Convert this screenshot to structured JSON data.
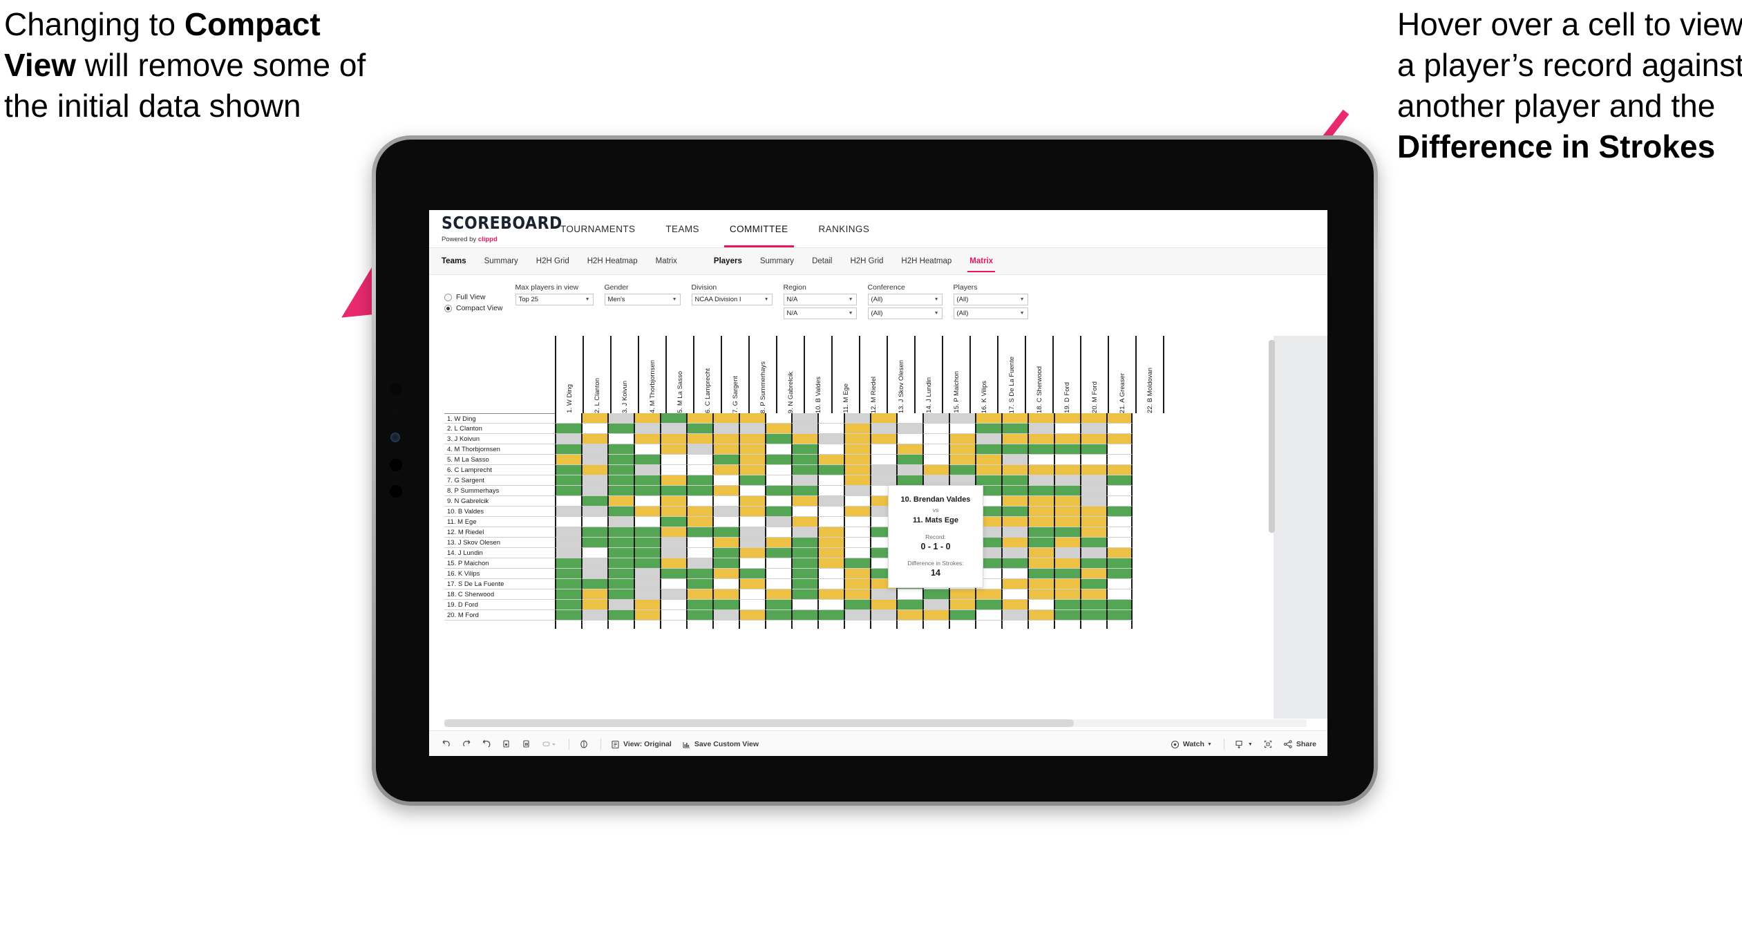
{
  "annotations": {
    "left": {
      "pre": "Changing to ",
      "bold": "Compact View",
      "post": " will remove some of the initial data shown"
    },
    "right": {
      "pre": "Hover over a cell to view a player’s record against another player and the ",
      "bold": "Difference in Strokes",
      "post": ""
    },
    "arrow_color": "#ea2a6e"
  },
  "app": {
    "logo": {
      "title": "SCOREBOARD",
      "powered_prefix": "Powered by ",
      "powered_brand": "clippd"
    },
    "top_nav": [
      {
        "label": "TOURNAMENTS",
        "active": false
      },
      {
        "label": "TEAMS",
        "active": false
      },
      {
        "label": "COMMITTEE",
        "active": true
      },
      {
        "label": "RANKINGS",
        "active": false
      }
    ],
    "sub_nav_teams": {
      "lead": "Teams",
      "items": [
        {
          "label": "Summary",
          "active": false
        },
        {
          "label": "H2H Grid",
          "active": false
        },
        {
          "label": "H2H Heatmap",
          "active": false
        },
        {
          "label": "Matrix",
          "active": false
        }
      ]
    },
    "sub_nav_players": {
      "lead": "Players",
      "items": [
        {
          "label": "Summary",
          "active": false
        },
        {
          "label": "Detail",
          "active": false
        },
        {
          "label": "H2H Grid",
          "active": false
        },
        {
          "label": "H2H Heatmap",
          "active": false
        },
        {
          "label": "Matrix",
          "active": true
        }
      ]
    },
    "view_options": [
      {
        "label": "Full View",
        "selected": false
      },
      {
        "label": "Compact View",
        "selected": true
      }
    ],
    "filters": [
      {
        "label": "Max players in view",
        "value": "Top 25",
        "value2": null
      },
      {
        "label": "Gender",
        "value": "Men's",
        "value2": null
      },
      {
        "label": "Division",
        "value": "NCAA Division I",
        "value2": null
      },
      {
        "label": "Region",
        "value": "N/A",
        "value2": "N/A"
      },
      {
        "label": "Conference",
        "value": "(All)",
        "value2": "(All)"
      },
      {
        "label": "Players",
        "value": "(All)",
        "value2": "(All)"
      }
    ],
    "tooltip": {
      "player_a": "10. Brendan Valdes",
      "vs": "vs",
      "player_b": "11. Mats Ege",
      "record_label": "Record:",
      "record_value": "0 - 1 - 0",
      "strokes_label": "Difference in Strokes:",
      "strokes_value": "14"
    },
    "toolbar": {
      "items": [
        {
          "icon": "undo-icon",
          "label": null
        },
        {
          "icon": "redo-icon",
          "label": null
        },
        {
          "icon": "revert-icon",
          "label": null
        },
        {
          "icon": "refresh-data-icon",
          "label": null
        },
        {
          "icon": "pause-updates-icon",
          "label": null
        },
        {
          "icon": "highlight-icon",
          "label": null
        },
        {
          "icon": "show-me-icon",
          "label": null
        },
        {
          "icon": "view-original-icon",
          "label": "View: Original"
        },
        {
          "icon": "save-custom-view-icon",
          "label": "Save Custom View"
        },
        {
          "icon": "watch-icon",
          "label": "Watch"
        },
        {
          "icon": "download-icon",
          "label": null
        },
        {
          "icon": "fullscreen-icon",
          "label": null
        },
        {
          "icon": "share-icon",
          "label": "Share"
        }
      ]
    }
  },
  "chart_data": {
    "type": "heatmap",
    "title": "Player Head-to-Head Matrix",
    "legend_colors": {
      "win": "#54a654",
      "tie": "#edc143",
      "loss": "#d2d2d2",
      "none": "#ffffff"
    },
    "row_labels": [
      "1. W Ding",
      "2. L Clanton",
      "3. J Koivun",
      "4. M Thorbjornsen",
      "5. M La Sasso",
      "6. C Lamprecht",
      "7. G Sargent",
      "8. P Summerhays",
      "9. N Gabrelcik",
      "10. B Valdes",
      "11. M Ege",
      "12. M Riedel",
      "13. J Skov Olesen",
      "14. J Lundin",
      "15. P Maichon",
      "16. K Vilips",
      "17. S De La Fuente",
      "18. C Sherwood",
      "19. D Ford",
      "20. M Ford"
    ],
    "column_labels": [
      "1. W Ding",
      "2. L Clanton",
      "3. J Koivun",
      "4. M Thorbjornsen",
      "5. M La Sasso",
      "6. C Lamprecht",
      "7. G Sargent",
      "8. P Summerhays",
      "9. N Gabrelcik",
      "10. B Valdes",
      "11. M Ege",
      "12. M Riedel",
      "13. J Skov Olesen",
      "14. J Lundin",
      "15. P Maichon",
      "16. K Vilips",
      "17. S De La Fuente",
      "18. C Sherwood",
      "19. D Ford",
      "20. M Ford",
      "21. A Greaser",
      "22. B Moldovan"
    ],
    "cells": [
      [
        "w",
        "y",
        "a",
        "y",
        "g",
        "y",
        "y",
        "y",
        "w",
        "a",
        "w",
        "a",
        "y",
        "w",
        "a",
        "a",
        "y",
        "y",
        "y",
        "y",
        "y",
        "y"
      ],
      [
        "g",
        "w",
        "g",
        "a",
        "a",
        "g",
        "a",
        "a",
        "y",
        "a",
        "w",
        "y",
        "a",
        "a",
        "w",
        "w",
        "g",
        "g",
        "a",
        "w",
        "a",
        "w"
      ],
      [
        "a",
        "y",
        "w",
        "y",
        "y",
        "y",
        "y",
        "y",
        "g",
        "y",
        "a",
        "y",
        "y",
        "w",
        "w",
        "y",
        "a",
        "y",
        "y",
        "y",
        "y",
        "y"
      ],
      [
        "g",
        "a",
        "g",
        "w",
        "y",
        "a",
        "y",
        "y",
        "w",
        "g",
        "w",
        "y",
        "w",
        "y",
        "w",
        "y",
        "g",
        "g",
        "g",
        "g",
        "g",
        "w"
      ],
      [
        "y",
        "a",
        "g",
        "g",
        "w",
        "w",
        "g",
        "y",
        "g",
        "g",
        "y",
        "y",
        "w",
        "g",
        "w",
        "y",
        "y",
        "a",
        "w",
        "w",
        "w",
        "w"
      ],
      [
        "g",
        "y",
        "g",
        "a",
        "w",
        "w",
        "y",
        "y",
        "w",
        "g",
        "g",
        "y",
        "a",
        "a",
        "y",
        "g",
        "y",
        "y",
        "y",
        "y",
        "y",
        "y"
      ],
      [
        "g",
        "a",
        "g",
        "g",
        "y",
        "g",
        "w",
        "g",
        "w",
        "a",
        "w",
        "y",
        "a",
        "g",
        "a",
        "a",
        "g",
        "g",
        "a",
        "a",
        "a",
        "g"
      ],
      [
        "g",
        "a",
        "g",
        "g",
        "g",
        "g",
        "y",
        "w",
        "g",
        "g",
        "w",
        "a",
        "w",
        "g",
        "a",
        "g",
        "g",
        "g",
        "g",
        "g",
        "a",
        "w"
      ],
      [
        "w",
        "g",
        "y",
        "w",
        "y",
        "w",
        "w",
        "y",
        "w",
        "y",
        "a",
        "w",
        "y",
        "g",
        "a",
        "y",
        "w",
        "y",
        "y",
        "y",
        "a",
        "w"
      ],
      [
        "a",
        "a",
        "g",
        "y",
        "y",
        "y",
        "a",
        "y",
        "g",
        "w",
        "w",
        "y",
        "a",
        "g",
        "a",
        "y",
        "g",
        "g",
        "y",
        "y",
        "y",
        "g"
      ],
      [
        "w",
        "w",
        "a",
        "w",
        "g",
        "y",
        "w",
        "w",
        "a",
        "y",
        "w",
        "w",
        "w",
        "g",
        "w",
        "w",
        "y",
        "y",
        "y",
        "y",
        "y",
        "w"
      ],
      [
        "a",
        "g",
        "g",
        "g",
        "y",
        "g",
        "g",
        "a",
        "w",
        "a",
        "y",
        "w",
        "g",
        "a",
        "a",
        "g",
        "a",
        "a",
        "g",
        "g",
        "y",
        "w"
      ],
      [
        "a",
        "g",
        "g",
        "g",
        "a",
        "w",
        "y",
        "a",
        "y",
        "g",
        "y",
        "w",
        "w",
        "g",
        "y",
        "y",
        "g",
        "y",
        "g",
        "y",
        "g",
        "w"
      ],
      [
        "a",
        "w",
        "g",
        "g",
        "a",
        "w",
        "g",
        "y",
        "g",
        "g",
        "y",
        "w",
        "g",
        "w",
        "a",
        "g",
        "a",
        "a",
        "y",
        "a",
        "a",
        "y"
      ],
      [
        "g",
        "a",
        "g",
        "g",
        "y",
        "a",
        "g",
        "w",
        "w",
        "g",
        "y",
        "g",
        "w",
        "w",
        "w",
        "y",
        "g",
        "g",
        "y",
        "y",
        "g",
        "g"
      ],
      [
        "g",
        "a",
        "g",
        "a",
        "g",
        "g",
        "y",
        "g",
        "w",
        "g",
        "w",
        "y",
        "g",
        "a",
        "y",
        "w",
        "w",
        "w",
        "g",
        "g",
        "y",
        "g"
      ],
      [
        "g",
        "g",
        "g",
        "a",
        "w",
        "g",
        "w",
        "y",
        "w",
        "g",
        "w",
        "y",
        "y",
        "g",
        "w",
        "w",
        "w",
        "y",
        "y",
        "y",
        "g",
        "w"
      ],
      [
        "g",
        "y",
        "g",
        "a",
        "a",
        "y",
        "y",
        "w",
        "y",
        "g",
        "y",
        "y",
        "a",
        "w",
        "g",
        "y",
        "y",
        "w",
        "y",
        "y",
        "y",
        "w"
      ],
      [
        "g",
        "y",
        "a",
        "y",
        "w",
        "g",
        "g",
        "w",
        "g",
        "w",
        "w",
        "g",
        "y",
        "g",
        "a",
        "y",
        "g",
        "y",
        "w",
        "g",
        "g",
        "g"
      ],
      [
        "g",
        "a",
        "g",
        "y",
        "w",
        "g",
        "a",
        "y",
        "g",
        "g",
        "g",
        "a",
        "a",
        "y",
        "y",
        "g",
        "w",
        "a",
        "y",
        "g",
        "g",
        "g"
      ]
    ]
  }
}
